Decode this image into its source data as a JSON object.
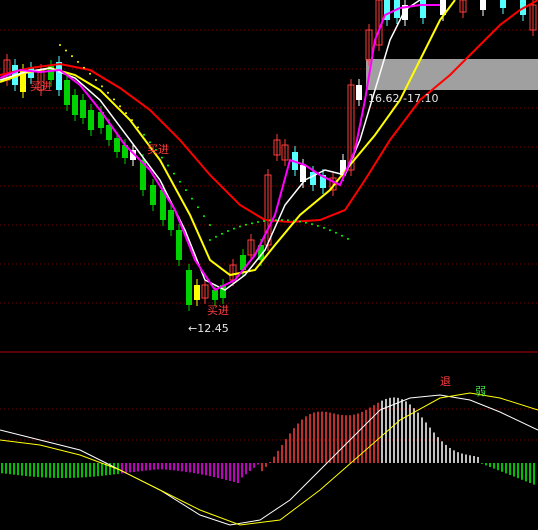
{
  "colors": {
    "background": "#000000",
    "up_candle": "#ff3c3c",
    "down_candle": "#00d200",
    "hollow_up": "#55ffff",
    "ma_white": "#ffffff",
    "ma_yellow": "#ffff00",
    "ma_magenta": "#ff00ff",
    "ma_red": "#ff0000",
    "dotted_green": "#00ff00",
    "dotted_yellow": "#ffff00",
    "separator": "#b40000",
    "shade": "#a0a0a0"
  },
  "annotations": {
    "buy_signal_1": "买进",
    "buy_signal_2": "买进",
    "buy_signal_3": "买进",
    "low_marker": "←12.45",
    "range_label": "16.62 -17.10",
    "macd_mark_1": "退",
    "macd_mark_2": "弱"
  },
  "chart_data": {
    "type": "candlestick",
    "title": "",
    "low_price": 12.45,
    "range_low": 16.62,
    "range_high": 17.1,
    "indicators": [
      "MA lines (white, yellow, magenta, red)",
      "MACD histogram (red/white/green/magenta bars)"
    ]
  }
}
